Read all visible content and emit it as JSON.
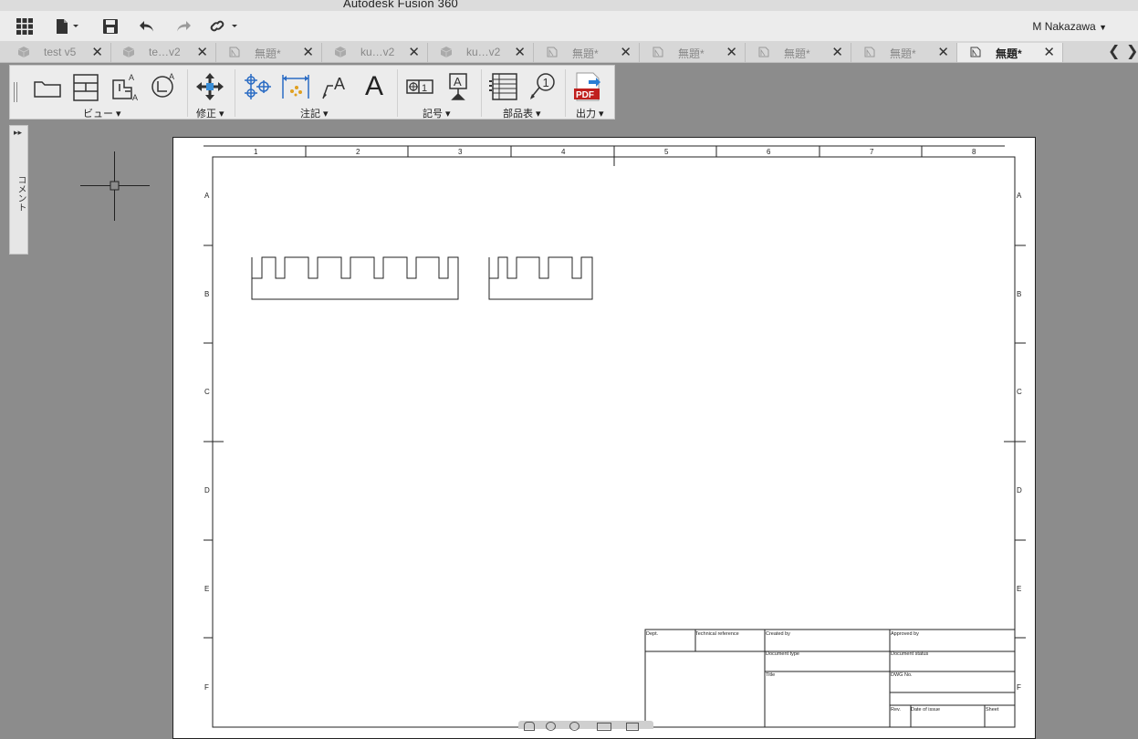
{
  "app": {
    "title": "Autodesk Fusion 360",
    "user": "M Nakazawa"
  },
  "toolbar": {
    "grid_icon": "grid-icon",
    "file_icon": "file-icon",
    "save_icon": "save-icon",
    "undo_icon": "undo-icon",
    "redo_icon": "redo-icon",
    "link_icon": "link-icon"
  },
  "tabs": [
    {
      "label": "test v5",
      "type": "model",
      "active": false
    },
    {
      "label": "te…v2",
      "type": "model",
      "active": false
    },
    {
      "label": "無題*",
      "type": "drawing",
      "active": false
    },
    {
      "label": "ku…v2",
      "type": "model",
      "active": false
    },
    {
      "label": "ku…v2",
      "type": "model",
      "active": false
    },
    {
      "label": "無題*",
      "type": "drawing",
      "active": false
    },
    {
      "label": "無題*",
      "type": "drawing",
      "active": false
    },
    {
      "label": "無題*",
      "type": "drawing",
      "active": false
    },
    {
      "label": "無題*",
      "type": "drawing",
      "active": false
    },
    {
      "label": "無題*",
      "type": "drawing",
      "active": true
    }
  ],
  "ribbon": {
    "groups": [
      {
        "label": "ビュー ▾"
      },
      {
        "label": "修正 ▾"
      },
      {
        "label": "注記 ▾"
      },
      {
        "label": "記号 ▾"
      },
      {
        "label": "部品表 ▾"
      },
      {
        "label": "出力 ▾"
      }
    ],
    "text_tool": "A",
    "pdf_label": "PDF"
  },
  "comment_panel": {
    "label": "コメント"
  },
  "sheet": {
    "columns": [
      "1",
      "2",
      "3",
      "4",
      "5",
      "6",
      "7",
      "8"
    ],
    "rows": [
      "A",
      "B",
      "C",
      "D",
      "E",
      "F"
    ]
  },
  "title_block": {
    "dept": "Dept.",
    "technical_reference": "Technical reference",
    "created_by": "Created by",
    "approved_by": "Approved by",
    "document_type": "Document type",
    "document_status": "Document status",
    "title": "Title",
    "dwg_no": "DWG No.",
    "rev": "Rev.",
    "date_of_issue": "Date of issue",
    "sheet": "Sheet"
  }
}
